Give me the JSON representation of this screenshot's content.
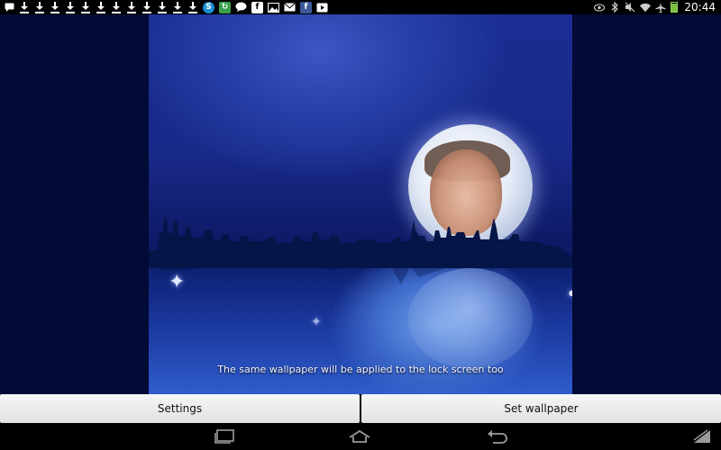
{
  "status_bar": {
    "time": "20:44",
    "battery_level": 0.9,
    "left_icons": [
      "message-icon",
      "download-icon",
      "download-icon",
      "download-icon",
      "download-icon",
      "download-icon",
      "download-icon",
      "download-icon",
      "download-icon",
      "download-icon",
      "download-icon",
      "download-icon",
      "download-icon",
      "skype-icon",
      "app-update-icon",
      "chat-bubble-icon",
      "flipboard-icon",
      "image-icon",
      "email-icon",
      "facebook-icon",
      "play-store-icon"
    ],
    "right_icons": [
      "eye-icon",
      "bluetooth-icon",
      "mute-icon",
      "wifi-icon",
      "airplane-icon",
      "battery-icon"
    ]
  },
  "preview": {
    "lock_screen_note": "The same wallpaper will be applied to the lock screen too"
  },
  "buttons": {
    "settings_label": "Settings",
    "set_wallpaper_label": "Set wallpaper"
  },
  "navigation": {
    "icons": [
      "recent-apps-icon",
      "home-icon",
      "back-icon",
      "screenshot-icon"
    ]
  },
  "colors": {
    "side_panel": "#020a36",
    "sky": "#1b2d93",
    "button_bg": "#efefef"
  }
}
